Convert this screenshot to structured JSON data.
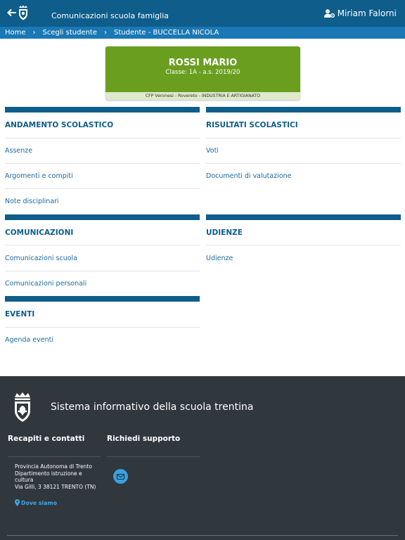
{
  "header": {
    "app_title": "Comunicazioni scuola famiglia",
    "user_name": "Miriam Falorni"
  },
  "breadcrumb": [
    "Home",
    "Scegli studente",
    "Studente - BUCCELLA NICOLA"
  ],
  "student_card": {
    "name": "ROSSI MARIO",
    "class_info": "Classe: 1A - a.s. 2019/20",
    "school": "CFP Veronesi - Rovereto - INDUSTRIA E ARTIGIANATO"
  },
  "sections": {
    "andamento": {
      "title": "ANDAMENTO SCOLASTICO",
      "items": [
        "Assenze",
        "Argomenti e compiti",
        "Note disciplinari"
      ]
    },
    "risultati": {
      "title": "RISULTATI SCOLASTICI",
      "items": [
        "Voti",
        "Documenti di valutazione"
      ]
    },
    "comunicazioni": {
      "title": "COMUNICAZIONI",
      "items": [
        "Comunicazioni scuola",
        "Comunicazioni personali"
      ]
    },
    "udienze": {
      "title": "UDIENZE",
      "items": [
        "Udienze"
      ]
    },
    "eventi": {
      "title": "EVENTI",
      "items": [
        "Agenda eventi"
      ]
    }
  },
  "footer": {
    "title": "Sistema informativo della scuola trentina",
    "contacts_heading": "Recapiti e contatti",
    "support_heading": "Richiedi supporto",
    "address_lines": [
      "Provincia Autonoma di Trento",
      "Dipartimento istruzione e",
      "cultura",
      "Via Gilli, 3 38121 TRENTO (TN)"
    ],
    "where_label": "Dove siamo"
  },
  "colors": {
    "header_bg": "#0e5d8b",
    "breadcrumb_bg": "#1a78b4",
    "card_green": "#6a9e1f",
    "footer_bg": "#30373d",
    "link": "#1a6aa0"
  }
}
